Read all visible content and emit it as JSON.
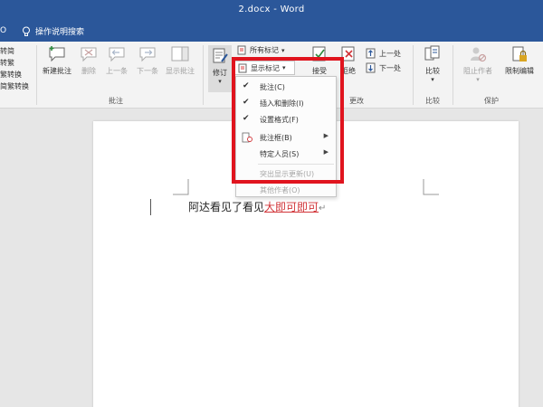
{
  "window": {
    "title": "2.docx  -  Word"
  },
  "tabrow": {
    "partial_tab": "O",
    "tell_me": "操作说明搜索"
  },
  "chinese_conv": {
    "items": [
      "转简",
      "转繁",
      "繁转换",
      "简繁转换"
    ],
    "group": ""
  },
  "comments": {
    "group": "批注",
    "new": "新建批注",
    "delete": "删除",
    "previous": "上一条",
    "next": "下一条",
    "show": "显示批注"
  },
  "tracking": {
    "track_changes": "修订",
    "markup_select": "所有标记",
    "show_markup": "显示标记"
  },
  "changes": {
    "group": "更改",
    "accept": "接受",
    "reject": "拒绝",
    "previous": "上一处",
    "next": "下一处"
  },
  "compare": {
    "group": "比较",
    "label": "比较"
  },
  "protect": {
    "group": "保护",
    "block_authors": "阻止作者",
    "restrict": "限制编辑"
  },
  "menu": {
    "items": [
      {
        "label": "批注(C)",
        "checked": true
      },
      {
        "label": "插入和删除(I)",
        "checked": true
      },
      {
        "label": "设置格式(F)",
        "checked": true
      },
      {
        "label": "批注框(B)",
        "submenu": true
      },
      {
        "label": "特定人员(S)",
        "submenu": true
      },
      {
        "label": "突出显示更新(U)",
        "disabled": true
      },
      {
        "label": "其他作者(O)",
        "disabled": true
      }
    ]
  },
  "document": {
    "plain_text": "阿达看见了看见",
    "inserted_text": "大即可即可",
    "colors": {
      "inserted": "#d13438"
    }
  },
  "colors": {
    "ribbon_blue": "#2b579a",
    "highlight": "#e0141e"
  }
}
